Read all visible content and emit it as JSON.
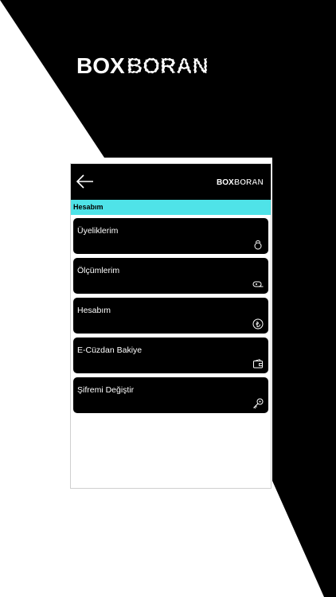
{
  "brand": {
    "name": "BOXBORAN",
    "part1": "BOX",
    "part2": "BORAN"
  },
  "header": {
    "back_icon": "arrow-left-icon",
    "logo_part1": "BOX",
    "logo_part2": "BORAN"
  },
  "section": {
    "title": "Hesabım"
  },
  "menu": [
    {
      "label": "Üyeliklerim",
      "icon": "kettlebell-icon"
    },
    {
      "label": "Ölçümlerim",
      "icon": "tape-measure-icon"
    },
    {
      "label": "Hesabım",
      "icon": "lira-coin-icon"
    },
    {
      "label": "E-Cüzdan Bakiye",
      "icon": "wallet-icon"
    },
    {
      "label": "Şifremi Değiştir",
      "icon": "key-icon"
    }
  ],
  "colors": {
    "accent": "#4fe3e8",
    "dark": "#000000",
    "light": "#ffffff"
  }
}
